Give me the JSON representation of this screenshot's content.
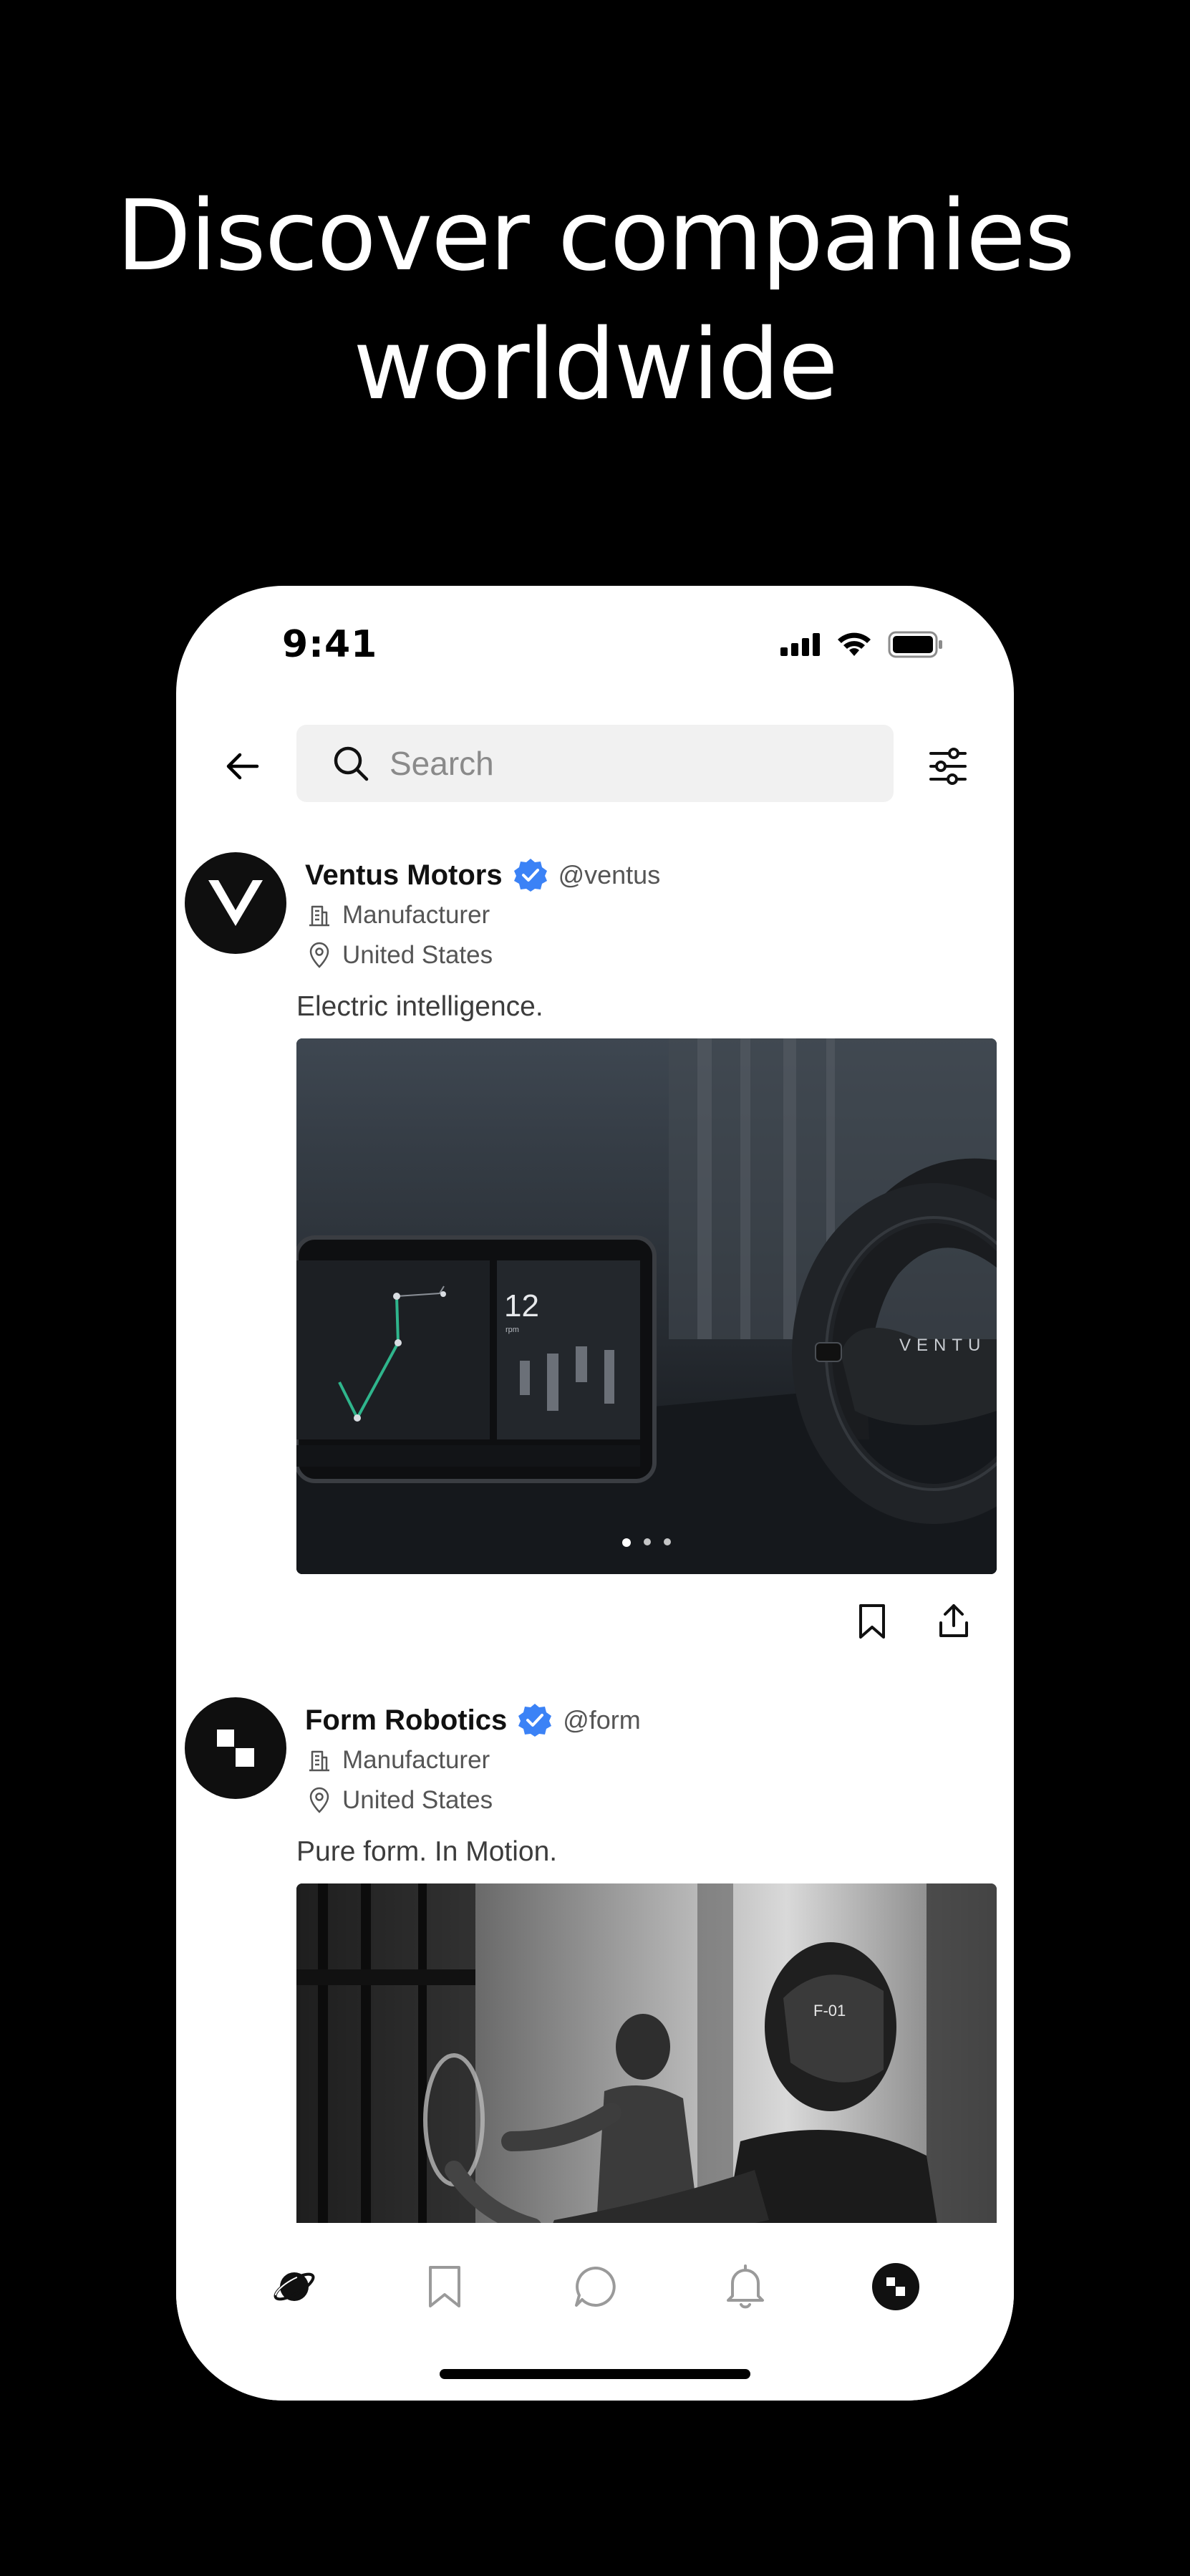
{
  "headline": {
    "line1": "Discover companies",
    "line2": "worldwide"
  },
  "status_bar": {
    "time": "9:41"
  },
  "search": {
    "placeholder": "Search",
    "value": ""
  },
  "posts": [
    {
      "name": "Ventus Motors",
      "handle": "@ventus",
      "category": "Manufacturer",
      "location": "United States",
      "tagline": "Electric intelligence.",
      "dash_time": "12",
      "dash_unit": "rpm",
      "wheel_text": "VENTU",
      "carousel_count": 3,
      "carousel_active": 1
    },
    {
      "name": "Form Robotics",
      "handle": "@form",
      "category": "Manufacturer",
      "location": "United States",
      "tagline": "Pure form. In Motion.",
      "robot_label": "F-01"
    }
  ],
  "bottom_nav": [
    "explore-icon",
    "bookmarks-icon",
    "messages-icon",
    "notifications-icon",
    "profile-avatar"
  ],
  "colors": {
    "background": "#000000",
    "verified": "#3b82f6",
    "surface": "#ffffff",
    "search_bg": "#f1f1f1"
  }
}
